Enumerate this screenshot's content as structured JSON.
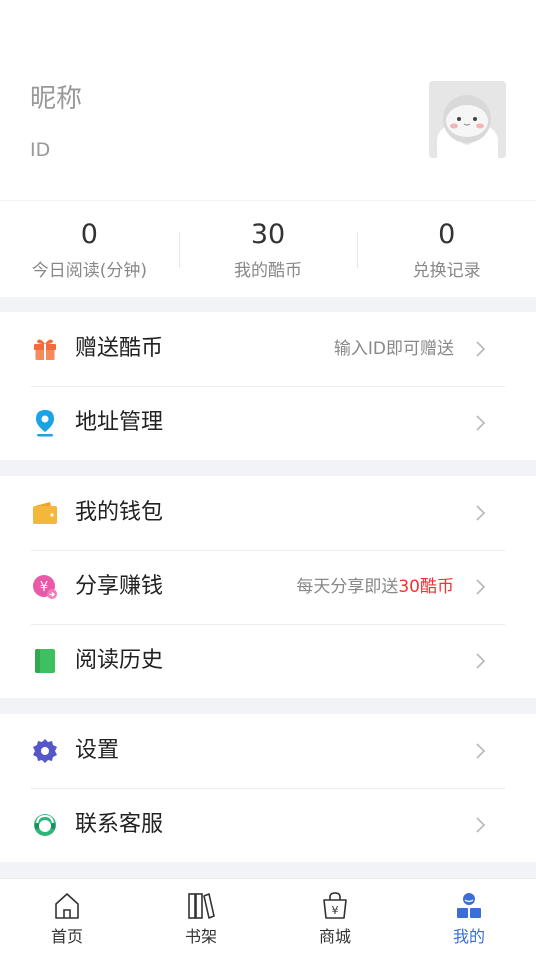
{
  "profile": {
    "nickname": "昵称",
    "id_label": "ID"
  },
  "stats": [
    {
      "value": "0",
      "label": "今日阅读(分钟)"
    },
    {
      "value": "30",
      "label": "我的酷币"
    },
    {
      "value": "0",
      "label": "兑换记录"
    }
  ],
  "menu": {
    "gift": {
      "label": "赠送酷币",
      "hint": "输入ID即可赠送",
      "icon": "gift-icon"
    },
    "address": {
      "label": "地址管理",
      "icon": "location-pin-icon"
    },
    "wallet": {
      "label": "我的钱包",
      "icon": "wallet-icon"
    },
    "share": {
      "label": "分享赚钱",
      "hint_prefix": "每天分享即送",
      "hint_accent": "30酷币",
      "icon": "share-coin-icon"
    },
    "history": {
      "label": "阅读历史",
      "icon": "book-icon"
    },
    "settings": {
      "label": "设置",
      "icon": "gear-icon"
    },
    "support": {
      "label": "联系客服",
      "icon": "headset-icon"
    }
  },
  "tabbar": [
    {
      "label": "首页",
      "icon": "home-icon"
    },
    {
      "label": "书架",
      "icon": "bookshelf-icon"
    },
    {
      "label": "商城",
      "icon": "shopping-bag-icon"
    },
    {
      "label": "我的",
      "icon": "user-icon",
      "active": true
    }
  ],
  "colors": {
    "accent_blue": "#3b6fd6",
    "hint_red": "#e33333",
    "gift_orange": "#f36b3b",
    "pin_blue": "#1aa3e6",
    "wallet_yellow": "#f5b73b",
    "share_pink": "#e85aa8",
    "book_green": "#3cc060",
    "gear_indigo": "#5556c9",
    "support_green": "#2db67a"
  }
}
